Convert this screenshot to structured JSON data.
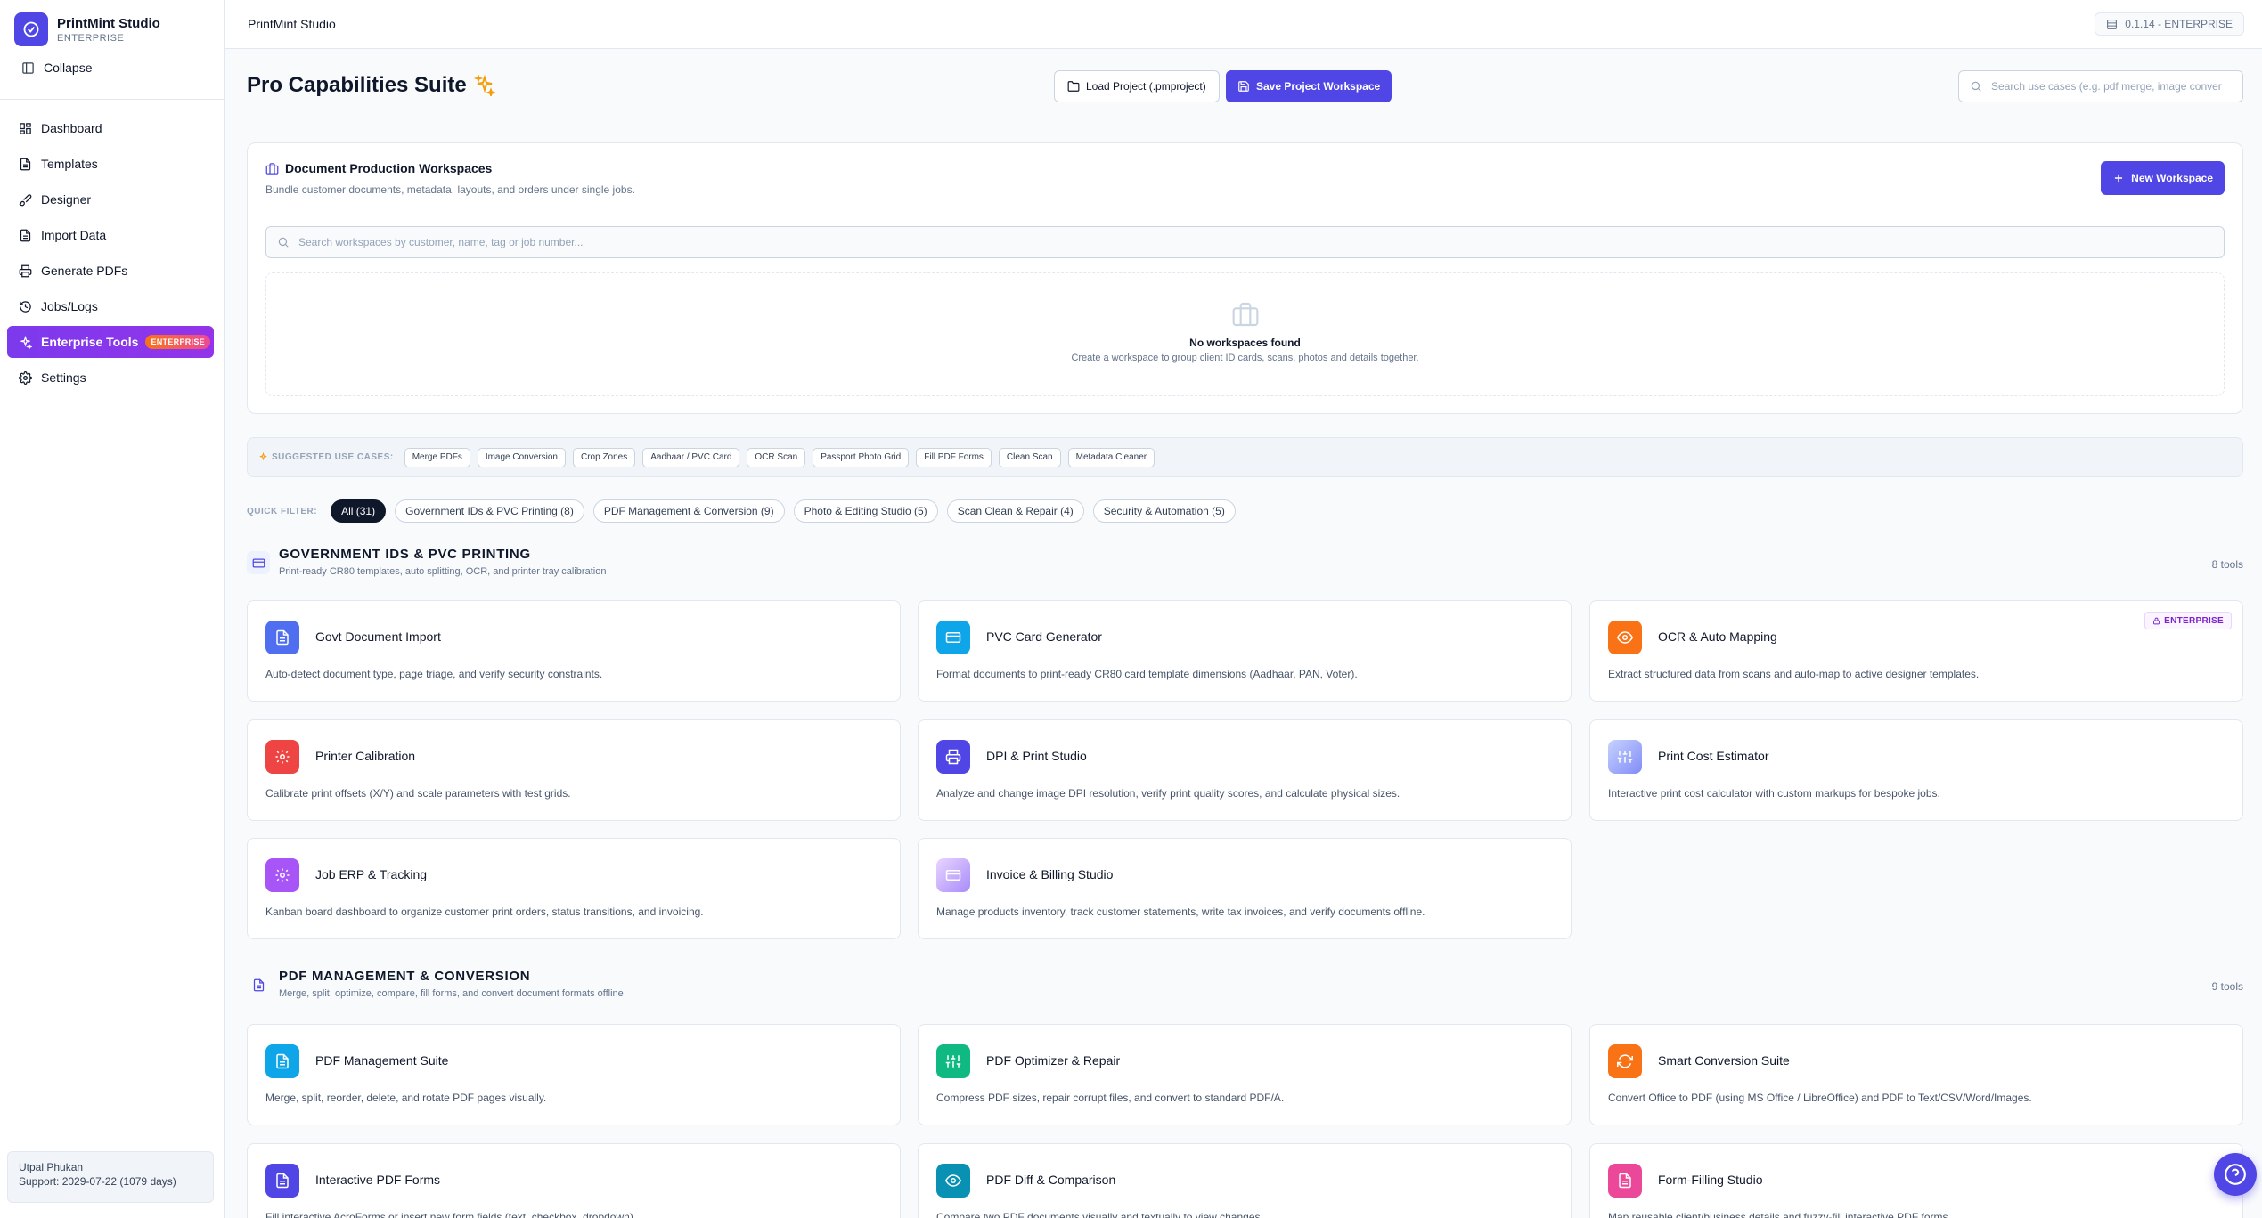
{
  "brand": {
    "name": "PrintMint Studio",
    "edition": "ENTERPRISE"
  },
  "sidebar": {
    "collapse_label": "Collapse",
    "items": [
      {
        "label": "Dashboard",
        "icon": "dashboard-icon"
      },
      {
        "label": "Templates",
        "icon": "file-icon"
      },
      {
        "label": "Designer",
        "icon": "brush-icon"
      },
      {
        "label": "Import Data",
        "icon": "file-icon"
      },
      {
        "label": "Generate PDFs",
        "icon": "printer-icon"
      },
      {
        "label": "Jobs/Logs",
        "icon": "history-icon"
      },
      {
        "label": "Enterprise Tools",
        "icon": "sparkles-icon",
        "badge": "ENTERPRISE",
        "active": true
      },
      {
        "label": "Settings",
        "icon": "gear-icon"
      }
    ],
    "user": {
      "name": "Utpal Phukan",
      "support": "Support: 2029-07-22 (1079 days)"
    }
  },
  "topbar": {
    "title": "PrintMint Studio",
    "version": "0.1.14 - ENTERPRISE"
  },
  "header": {
    "title": "Pro Capabilities Suite",
    "load_button": "Load Project (.pmproject)",
    "save_button": "Save Project Workspace",
    "search_placeholder": "Search use cases (e.g. pdf merge, image conver"
  },
  "workspaces": {
    "title": "Document Production Workspaces",
    "subtitle": "Bundle customer documents, metadata, layouts, and orders under single jobs.",
    "new_button": "New Workspace",
    "search_placeholder": "Search workspaces by customer, name, tag or job number...",
    "empty_title": "No workspaces found",
    "empty_subtitle": "Create a workspace to group client ID cards, scans, photos and details together."
  },
  "suggested": {
    "label": "SUGGESTED USE CASES:",
    "chips": [
      "Merge PDFs",
      "Image Conversion",
      "Crop Zones",
      "Aadhaar / PVC Card",
      "OCR Scan",
      "Passport Photo Grid",
      "Fill PDF Forms",
      "Clean Scan",
      "Metadata Cleaner"
    ]
  },
  "quick_filter": {
    "label": "QUICK FILTER:",
    "pills": [
      {
        "label": "All (31)",
        "active": true
      },
      {
        "label": "Government IDs & PVC Printing (8)"
      },
      {
        "label": "PDF Management & Conversion (9)"
      },
      {
        "label": "Photo & Editing Studio (5)"
      },
      {
        "label": "Scan Clean & Repair (4)"
      },
      {
        "label": "Security & Automation (5)"
      }
    ]
  },
  "sections": [
    {
      "title": "GOVERNMENT IDS & PVC PRINTING",
      "subtitle": "Print-ready CR80 templates, auto splitting, OCR, and printer tray calibration",
      "count": "8 tools",
      "cards": [
        {
          "title": "Govt Document Import",
          "desc": "Auto-detect document type, page triage, and verify security constraints.",
          "color": "#4f6ef0",
          "icon": "file-icon"
        },
        {
          "title": "PVC Card Generator",
          "desc": "Format documents to print-ready CR80 card template dimensions (Aadhaar, PAN, Voter).",
          "color": "#0ea5e9",
          "icon": "card-icon"
        },
        {
          "title": "OCR & Auto Mapping",
          "desc": "Extract structured data from scans and auto-map to active designer templates.",
          "color": "#f97316",
          "icon": "eye-icon",
          "badge": "ENTERPRISE"
        },
        {
          "title": "Printer Calibration",
          "desc": "Calibrate print offsets (X/Y) and scale parameters with test grids.",
          "color": "#ef4444",
          "icon": "gear-icon"
        },
        {
          "title": "DPI & Print Studio",
          "desc": "Analyze and change image DPI resolution, verify print quality scores, and calculate physical sizes.",
          "color": "#4f46e5",
          "icon": "printer-icon"
        },
        {
          "title": "Print Cost Estimator",
          "desc": "Interactive print cost calculator with custom markups for bespoke jobs.",
          "color": "#a5b4fc",
          "icon": "sliders-icon"
        },
        {
          "title": "Job ERP & Tracking",
          "desc": "Kanban board dashboard to organize customer print orders, status transitions, and invoicing.",
          "color": "#a855f7",
          "icon": "gear-icon"
        },
        {
          "title": "Invoice & Billing Studio",
          "desc": "Manage products inventory, track customer statements, write tax invoices, and verify documents offline.",
          "color": "#c084fc",
          "icon": "card-icon"
        }
      ]
    },
    {
      "title": "PDF MANAGEMENT & CONVERSION",
      "subtitle": "Merge, split, optimize, compare, fill forms, and convert document formats offline",
      "count": "9 tools",
      "cards": [
        {
          "title": "PDF Management Suite",
          "desc": "Merge, split, reorder, delete, and rotate PDF pages visually.",
          "color": "#0ea5e9",
          "icon": "file-icon"
        },
        {
          "title": "PDF Optimizer & Repair",
          "desc": "Compress PDF sizes, repair corrupt files, and convert to standard PDF/A.",
          "color": "#10b981",
          "icon": "sliders-icon"
        },
        {
          "title": "Smart Conversion Suite",
          "desc": "Convert Office to PDF (using MS Office / LibreOffice) and PDF to Text/CSV/Word/Images.",
          "color": "#f97316",
          "icon": "refresh-icon"
        },
        {
          "title": "Interactive PDF Forms",
          "desc": "Fill interactive AcroForms or insert new form fields (text, checkbox, dropdown).",
          "color": "#4f46e5",
          "icon": "file-icon"
        },
        {
          "title": "PDF Diff & Comparison",
          "desc": "Compare two PDF documents visually and textually to view changes.",
          "color": "#0891b2",
          "icon": "eye-icon"
        },
        {
          "title": "Form-Filling Studio",
          "desc": "Map reusable client/business details and fuzzy-fill interactive PDF forms.",
          "color": "#ec4899",
          "icon": "file-icon"
        }
      ]
    }
  ],
  "colors": {
    "accent": "#4f46e5",
    "active_nav": "#7c3aed"
  }
}
